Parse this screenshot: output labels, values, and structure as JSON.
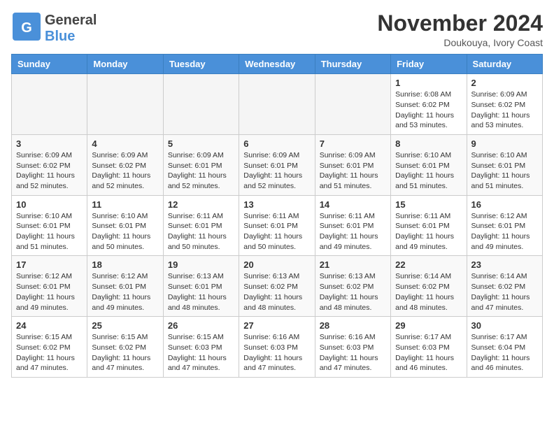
{
  "header": {
    "logo_general": "General",
    "logo_blue": "Blue",
    "month_title": "November 2024",
    "location": "Doukouya, Ivory Coast"
  },
  "calendar": {
    "days_of_week": [
      "Sunday",
      "Monday",
      "Tuesday",
      "Wednesday",
      "Thursday",
      "Friday",
      "Saturday"
    ],
    "weeks": [
      [
        {
          "day": "",
          "info": ""
        },
        {
          "day": "",
          "info": ""
        },
        {
          "day": "",
          "info": ""
        },
        {
          "day": "",
          "info": ""
        },
        {
          "day": "",
          "info": ""
        },
        {
          "day": "1",
          "info": "Sunrise: 6:08 AM\nSunset: 6:02 PM\nDaylight: 11 hours\nand 53 minutes."
        },
        {
          "day": "2",
          "info": "Sunrise: 6:09 AM\nSunset: 6:02 PM\nDaylight: 11 hours\nand 53 minutes."
        }
      ],
      [
        {
          "day": "3",
          "info": "Sunrise: 6:09 AM\nSunset: 6:02 PM\nDaylight: 11 hours\nand 52 minutes."
        },
        {
          "day": "4",
          "info": "Sunrise: 6:09 AM\nSunset: 6:02 PM\nDaylight: 11 hours\nand 52 minutes."
        },
        {
          "day": "5",
          "info": "Sunrise: 6:09 AM\nSunset: 6:01 PM\nDaylight: 11 hours\nand 52 minutes."
        },
        {
          "day": "6",
          "info": "Sunrise: 6:09 AM\nSunset: 6:01 PM\nDaylight: 11 hours\nand 52 minutes."
        },
        {
          "day": "7",
          "info": "Sunrise: 6:09 AM\nSunset: 6:01 PM\nDaylight: 11 hours\nand 51 minutes."
        },
        {
          "day": "8",
          "info": "Sunrise: 6:10 AM\nSunset: 6:01 PM\nDaylight: 11 hours\nand 51 minutes."
        },
        {
          "day": "9",
          "info": "Sunrise: 6:10 AM\nSunset: 6:01 PM\nDaylight: 11 hours\nand 51 minutes."
        }
      ],
      [
        {
          "day": "10",
          "info": "Sunrise: 6:10 AM\nSunset: 6:01 PM\nDaylight: 11 hours\nand 51 minutes."
        },
        {
          "day": "11",
          "info": "Sunrise: 6:10 AM\nSunset: 6:01 PM\nDaylight: 11 hours\nand 50 minutes."
        },
        {
          "day": "12",
          "info": "Sunrise: 6:11 AM\nSunset: 6:01 PM\nDaylight: 11 hours\nand 50 minutes."
        },
        {
          "day": "13",
          "info": "Sunrise: 6:11 AM\nSunset: 6:01 PM\nDaylight: 11 hours\nand 50 minutes."
        },
        {
          "day": "14",
          "info": "Sunrise: 6:11 AM\nSunset: 6:01 PM\nDaylight: 11 hours\nand 49 minutes."
        },
        {
          "day": "15",
          "info": "Sunrise: 6:11 AM\nSunset: 6:01 PM\nDaylight: 11 hours\nand 49 minutes."
        },
        {
          "day": "16",
          "info": "Sunrise: 6:12 AM\nSunset: 6:01 PM\nDaylight: 11 hours\nand 49 minutes."
        }
      ],
      [
        {
          "day": "17",
          "info": "Sunrise: 6:12 AM\nSunset: 6:01 PM\nDaylight: 11 hours\nand 49 minutes."
        },
        {
          "day": "18",
          "info": "Sunrise: 6:12 AM\nSunset: 6:01 PM\nDaylight: 11 hours\nand 49 minutes."
        },
        {
          "day": "19",
          "info": "Sunrise: 6:13 AM\nSunset: 6:01 PM\nDaylight: 11 hours\nand 48 minutes."
        },
        {
          "day": "20",
          "info": "Sunrise: 6:13 AM\nSunset: 6:02 PM\nDaylight: 11 hours\nand 48 minutes."
        },
        {
          "day": "21",
          "info": "Sunrise: 6:13 AM\nSunset: 6:02 PM\nDaylight: 11 hours\nand 48 minutes."
        },
        {
          "day": "22",
          "info": "Sunrise: 6:14 AM\nSunset: 6:02 PM\nDaylight: 11 hours\nand 48 minutes."
        },
        {
          "day": "23",
          "info": "Sunrise: 6:14 AM\nSunset: 6:02 PM\nDaylight: 11 hours\nand 47 minutes."
        }
      ],
      [
        {
          "day": "24",
          "info": "Sunrise: 6:15 AM\nSunset: 6:02 PM\nDaylight: 11 hours\nand 47 minutes."
        },
        {
          "day": "25",
          "info": "Sunrise: 6:15 AM\nSunset: 6:02 PM\nDaylight: 11 hours\nand 47 minutes."
        },
        {
          "day": "26",
          "info": "Sunrise: 6:15 AM\nSunset: 6:03 PM\nDaylight: 11 hours\nand 47 minutes."
        },
        {
          "day": "27",
          "info": "Sunrise: 6:16 AM\nSunset: 6:03 PM\nDaylight: 11 hours\nand 47 minutes."
        },
        {
          "day": "28",
          "info": "Sunrise: 6:16 AM\nSunset: 6:03 PM\nDaylight: 11 hours\nand 47 minutes."
        },
        {
          "day": "29",
          "info": "Sunrise: 6:17 AM\nSunset: 6:03 PM\nDaylight: 11 hours\nand 46 minutes."
        },
        {
          "day": "30",
          "info": "Sunrise: 6:17 AM\nSunset: 6:04 PM\nDaylight: 11 hours\nand 46 minutes."
        }
      ]
    ]
  }
}
